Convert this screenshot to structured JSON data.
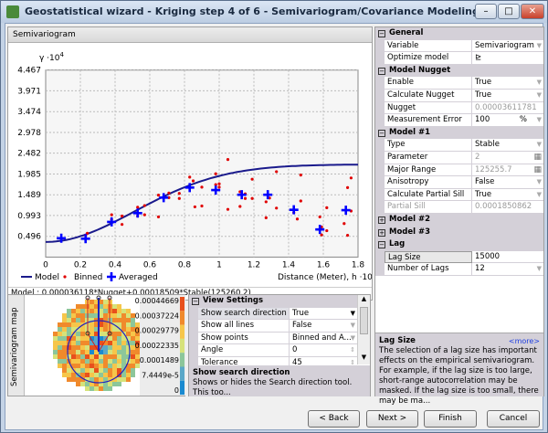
{
  "window": {
    "title": "Geostatistical wizard - Kriging step 4 of 6 - Semivariogram/Covariance Modeling",
    "min": "–",
    "max": "□",
    "close": "✕"
  },
  "semivariogram": {
    "panel_title": "Semivariogram",
    "ylabel": "γ ·10",
    "ylabel_exp": "4",
    "xlabel": "Distance (Meter), h ·10",
    "xlabel_exp": "-5",
    "yticks": [
      "0.496",
      "0.993",
      "1.489",
      "1.985",
      "2.482",
      "2.978",
      "3.474",
      "3.971",
      "4.467"
    ],
    "xticks": [
      "0",
      "0.2",
      "0.4",
      "0.6",
      "0.8",
      "1",
      "1.2",
      "1.4",
      "1.6",
      "1.8"
    ],
    "legend": {
      "model": "Model",
      "binned": "Binned",
      "averaged": "Averaged"
    },
    "model_text": "Model : 0.000036118*Nugget+0.00018509*Stable(125260,2)",
    "colors": {
      "model": "#1a1a8c",
      "binned": "#e00000",
      "averaged": "#0000ff"
    }
  },
  "chart_data": {
    "type": "scatter",
    "xlim": [
      0,
      1.8
    ],
    "ylim": [
      0,
      4.467
    ],
    "grid": true,
    "legend_placement": "bottom",
    "model": {
      "nugget": 0.36118,
      "partial_sill": 1.8509,
      "range": 1.2526,
      "parameter": 2
    },
    "averaged": [
      [
        0.09,
        0.45
      ],
      [
        0.23,
        0.44
      ],
      [
        0.38,
        0.84
      ],
      [
        0.53,
        1.05
      ],
      [
        0.68,
        1.42
      ],
      [
        0.83,
        1.66
      ],
      [
        0.98,
        1.6
      ],
      [
        1.13,
        1.49
      ],
      [
        1.28,
        1.49
      ],
      [
        1.43,
        1.13
      ],
      [
        1.58,
        0.66
      ],
      [
        1.73,
        1.12
      ]
    ],
    "binned": [
      [
        0.24,
        0.57
      ],
      [
        0.23,
        0.52
      ],
      [
        0.38,
        1.01
      ],
      [
        0.38,
        0.9
      ],
      [
        0.44,
        0.98
      ],
      [
        0.44,
        0.78
      ],
      [
        0.53,
        1.19
      ],
      [
        0.53,
        0.98
      ],
      [
        0.57,
        1.23
      ],
      [
        0.57,
        1.01
      ],
      [
        0.65,
        1.48
      ],
      [
        0.65,
        0.96
      ],
      [
        0.71,
        1.53
      ],
      [
        0.71,
        1.42
      ],
      [
        0.77,
        1.52
      ],
      [
        0.77,
        1.4
      ],
      [
        0.83,
        1.91
      ],
      [
        0.85,
        1.82
      ],
      [
        0.86,
        1.2
      ],
      [
        0.9,
        1.67
      ],
      [
        0.9,
        1.22
      ],
      [
        0.98,
        1.99
      ],
      [
        0.98,
        1.73
      ],
      [
        1.0,
        1.75
      ],
      [
        1.0,
        1.67
      ],
      [
        1.05,
        2.33
      ],
      [
        1.05,
        1.14
      ],
      [
        1.12,
        1.56
      ],
      [
        1.12,
        1.21
      ],
      [
        1.15,
        1.51
      ],
      [
        1.15,
        1.4
      ],
      [
        1.19,
        1.86
      ],
      [
        1.19,
        1.4
      ],
      [
        1.27,
        1.32
      ],
      [
        1.27,
        0.94
      ],
      [
        1.29,
        1.41
      ],
      [
        1.33,
        2.04
      ],
      [
        1.33,
        1.17
      ],
      [
        1.43,
        1.06
      ],
      [
        1.45,
        0.91
      ],
      [
        1.47,
        1.96
      ],
      [
        1.47,
        1.34
      ],
      [
        1.58,
        0.96
      ],
      [
        1.59,
        0.72
      ],
      [
        1.59,
        0.53
      ],
      [
        1.62,
        1.18
      ],
      [
        1.62,
        0.63
      ],
      [
        1.72,
        0.8
      ],
      [
        1.74,
        1.66
      ],
      [
        1.74,
        0.52
      ],
      [
        1.76,
        1.89
      ],
      [
        1.76,
        1.1
      ]
    ]
  },
  "map": {
    "label": "Semivariogram map",
    "legend": [
      "0.00044669",
      "0.00037224",
      "0.00029779",
      "0.00022335",
      "0.0001489",
      "7.4449e-5",
      "0"
    ],
    "legend_colors": [
      "#e8501c",
      "#f08a2c",
      "#f6c64a",
      "#d6e27a",
      "#8cc69a",
      "#5aa8c8",
      "#1a8ad0"
    ]
  },
  "view_settings": {
    "title": "View Settings",
    "rows": [
      {
        "k": "Show search direction",
        "v": "True"
      },
      {
        "k": "Show all lines",
        "v": "False"
      },
      {
        "k": "Show points",
        "v": "Binned and A..."
      },
      {
        "k": "Angle",
        "v": "0"
      },
      {
        "k": "Tolerance",
        "v": "45"
      }
    ],
    "desc_title": "Show search direction",
    "desc": "Shows or hides the Search direction tool. This too..."
  },
  "props": [
    {
      "cat": "General",
      "open": true
    },
    {
      "k": "Variable",
      "v": "Semivariogram",
      "dd": true
    },
    {
      "k": "Optimize model",
      "v": "⊵"
    },
    {
      "cat": "Model Nugget",
      "open": true
    },
    {
      "k": "Enable",
      "v": "True",
      "dd": true
    },
    {
      "k": "Calculate Nugget",
      "v": "True",
      "dd": true
    },
    {
      "k": "Nugget",
      "v": "0.00003611781",
      "dis": true
    },
    {
      "k": "Measurement Error",
      "v": "100",
      "unit": "%",
      "dd": true
    },
    {
      "cat": "Model #1",
      "open": true
    },
    {
      "k": "Type",
      "v": "Stable",
      "dd": true
    },
    {
      "k": "Parameter",
      "v": "2",
      "dis": true,
      "calc": true
    },
    {
      "k": "Major Range",
      "v": "125255.7",
      "dis": true,
      "calc": true
    },
    {
      "k": "Anisotropy",
      "v": "False",
      "dd": true
    },
    {
      "k": "Calculate Partial Sill",
      "v": "True",
      "dd": true
    },
    {
      "k": "Partial Sill",
      "v": "0.0001850862",
      "dis": true,
      "kdis": true
    },
    {
      "cat": "Model #2",
      "open": false
    },
    {
      "cat": "Model #3",
      "open": false
    },
    {
      "cat": "Lag",
      "open": true
    },
    {
      "k": "Lag Size",
      "v": "15000",
      "sel": true
    },
    {
      "k": "Number of Lags",
      "v": "12",
      "dd": true
    }
  ],
  "help": {
    "title": "Lag Size",
    "more": "<more>",
    "text": "The selection of a lag size has important effects on the empirical semivariogram. For example, if the lag size is too large, short-range autocorrelation may be masked. If the lag size is too small, there may be ma..."
  },
  "buttons": {
    "back": "< Back",
    "next": "Next >",
    "finish": "Finish",
    "cancel": "Cancel"
  }
}
